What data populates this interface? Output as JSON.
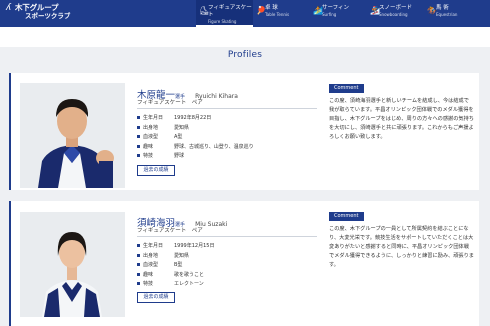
{
  "header": {
    "logo_line1": "木下グループ",
    "logo_line2": "スポーツクラブ",
    "nav": [
      {
        "jp": "フィギュアスケート",
        "en": "Figure Skating",
        "icon": "skater-icon",
        "glyph": "⛸",
        "active": true
      },
      {
        "jp": "卓 球",
        "en": "Table Tennis",
        "icon": "table-tennis-icon",
        "glyph": "🏓",
        "active": false
      },
      {
        "jp": "サーフィン",
        "en": "Surfing",
        "icon": "surfing-icon",
        "glyph": "🏄",
        "active": false
      },
      {
        "jp": "スノーボード",
        "en": "Snowboarding",
        "icon": "snowboard-icon",
        "glyph": "🏂",
        "active": false
      },
      {
        "jp": "馬 術",
        "en": "Equestrian",
        "icon": "equestrian-icon",
        "glyph": "🏇",
        "active": false
      }
    ]
  },
  "page": {
    "title": "Profiles"
  },
  "profiles": [
    {
      "name_jp": "木原龍一",
      "name_suffix": "選手",
      "name_en": "Ryuichi Kihara",
      "sub": "フィギュアスケート　ペア",
      "info": [
        {
          "k": "生年月日",
          "v": "1992年8月22日"
        },
        {
          "k": "出身地",
          "v": "愛知県"
        },
        {
          "k": "血液型",
          "v": "A型"
        },
        {
          "k": "趣味",
          "v": "野球、古城巡り、山登り、温泉巡り"
        },
        {
          "k": "特技",
          "v": "野球"
        }
      ],
      "button": "過去の成績",
      "comment_label": "Comment",
      "comment": "この度、須崎海羽選手と新しいチームを結成し、今は結成で我が取らています。平昌オリンピック団体戦でのメダル獲得を目指し、木下グループをはじめ、周りの方々への感謝の気持ちを大切にし、須崎選手と共に頑張ります。これからもご声援よろしくお願い致します。"
    },
    {
      "name_jp": "須崎海羽",
      "name_suffix": "選手",
      "name_en": "Miu Suzaki",
      "sub": "フィギュアスケート　ペア",
      "info": [
        {
          "k": "生年月日",
          "v": "1999年12月15日"
        },
        {
          "k": "出身地",
          "v": "愛知県"
        },
        {
          "k": "血液型",
          "v": "B型"
        },
        {
          "k": "趣味",
          "v": "歌を歌うこと"
        },
        {
          "k": "特技",
          "v": "エレクトーン"
        }
      ],
      "button": "過去の成績",
      "comment_label": "Comment",
      "comment": "この度、木下グループの一員として所属契約を結ぶことになり、大変光栄です。競技生活をサポートしていただくことは大変ありがたいと感謝すると同時に、平昌オリンピック団体戦でメダル獲得できるように、しっかりと練習に励み、頑張ります。"
    }
  ]
}
